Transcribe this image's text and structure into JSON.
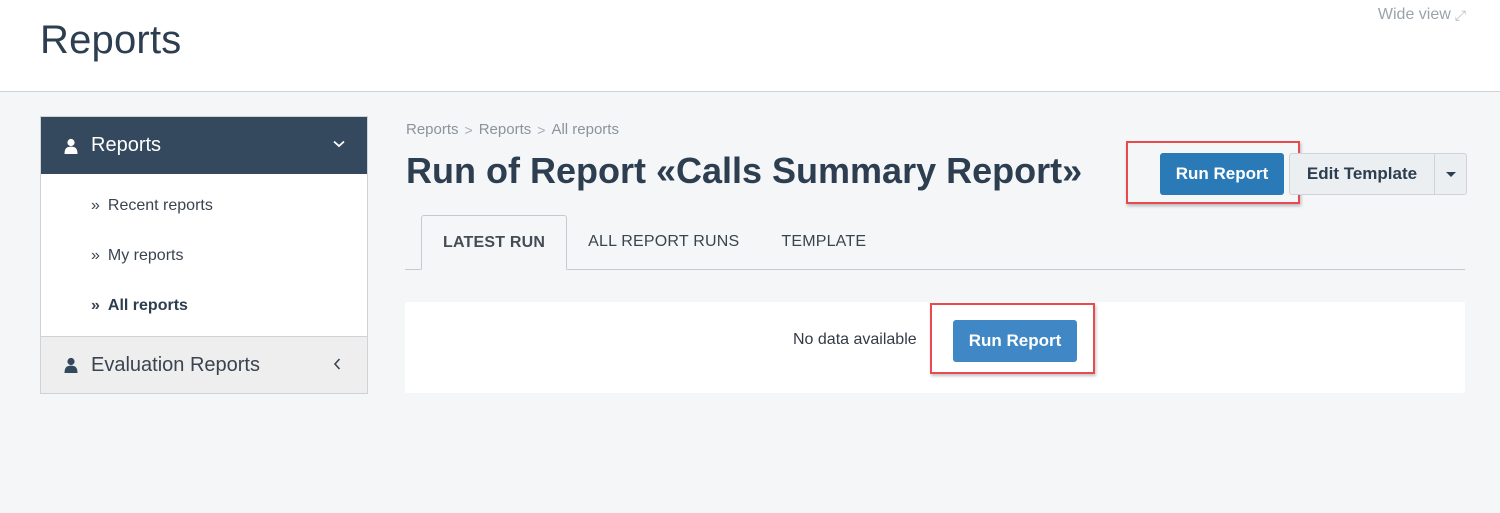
{
  "header": {
    "title": "Reports",
    "wide_view_label": "Wide view",
    "wide_view_icon": "expand-icon"
  },
  "sidebar": {
    "section": {
      "label": "Reports",
      "icon": "person-icon",
      "expanded": true,
      "items": [
        {
          "label": "Recent reports",
          "active": false
        },
        {
          "label": "My reports",
          "active": false
        },
        {
          "label": "All reports",
          "active": true
        }
      ]
    },
    "group": {
      "label": "Evaluation Reports",
      "icon": "person-icon",
      "expanded": false
    }
  },
  "breadcrumb": [
    "Reports",
    "Reports",
    "All reports"
  ],
  "page_title": "Run of Report «Calls Summary Report»",
  "toolbar": {
    "run_report_label": "Run Report",
    "edit_template_label": "Edit Template"
  },
  "tabs": [
    {
      "label": "LATEST RUN",
      "active": true
    },
    {
      "label": "ALL REPORT RUNS",
      "active": false
    },
    {
      "label": "TEMPLATE",
      "active": false
    }
  ],
  "content": {
    "empty_message": "No data available",
    "run_report_label": "Run Report"
  },
  "colors": {
    "primary": "#2a7ab8",
    "sidebar_header": "#34495e",
    "highlight": "#e94a4f"
  }
}
